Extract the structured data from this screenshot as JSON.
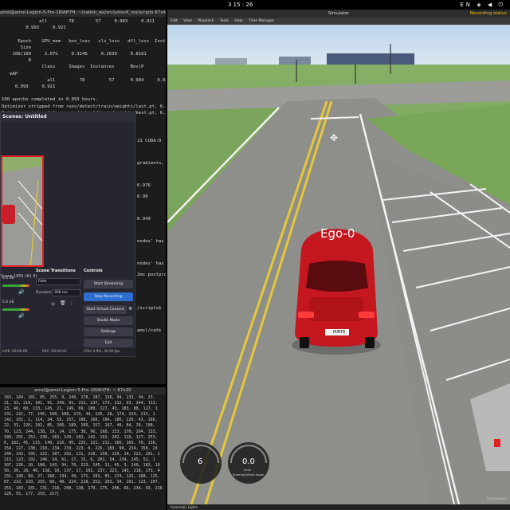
{
  "topbar": {
    "left_label": "",
    "clock": "3  15 : 26",
    "right_label": "EN"
  },
  "term1": {
    "title": "amsl@amsl-Legion-5-Pro-16IAH7H: ~/catkin_ws/src/yolov8_ros/scripts 67x41",
    "lines": [
      "              all        78        57     0.983     0.921",
      "         0.993     0.921",
      "",
      "      Epoch    GPU_mem   box_loss   cls_loss   dfl_loss  Instances",
      "       Size",
      "    100/100     2.07G     0.3246     0.2639     0.8181         0",
      "          8",
      "               Class     Images  Instances      Box(P",
      "   mAP",
      "                 all         78         57      0.984     0.983",
      "     0.993     0.921",
      "",
      "100 epochs completed in 0.093 hours.",
      "Optimizer stripped from runs/detect/train/weights/last.pt, 6.3MB",
      "Optimizer stripped from runs/detect/train/weights/best.pt, 6.3MB"
    ],
    "side_lines": [
      "",
      "",
      "",
      "",
      "11 CUDA:0",
      "",
      "gradients,",
      "",
      "0.976",
      "0.98",
      "",
      "0.949",
      "",
      "nodes' has",
      "",
      "nodes' has",
      "2ms postpro",
      "",
      "",
      "/scripts$",
      "",
      "amsl/catk"
    ]
  },
  "term2": {
    "title": "amsl@amsl-Legion-5-Pro-16IAH7H: ~ 67x20",
    "lines": [
      " 183, 184, 181, 85, 255, 9, 240, 178, 187, 136, 94, 233, 94, 23,",
      " 21, 33, 219, 101, 91, 240, 91, 213, 237, 173, 212, 93, 244, 113,",
      " 23, 48, 60, 133, 145, 21, 149, 69, 100, 127, 43, 183, 88, 117, 1",
      " 231, 221, 77, 146, 168, 188, 219, 49, 126, 28, 174, 226, 215, 1",
      " 142, 101, 1, 114, 34, 53, 157, 108, 160, 184, 186, 226, 43, 166,",
      " 22, 31, 126, 102, 85, 206, 189, 109, 157, 167, 46, 84, 29, 190,",
      " 70, 123, 244, 138, 19, 14, 175, 30, 96, 198, 153, 170, 204, 133,",
      " 180, 201, 252, 230, 163, 143, 102, 142, 192, 202, 119, 127, 253,",
      " 6, 181, 45, 115, 140, 216, 45, 225, 221, 211, 166, 165, 70, 116,",
      " 154, 127, 138, 210, 234, 233, 223, 0, 226, 183, 98, 234, 158, 23",
      " 249, 142, 105, 222, 187, 162, 131, 228, 150, 129, 14, 223, 201, 2",
      " 115, 123, 102, 246, 34, 61, 27, 15, 6, 201, 54, 234, 245, 52, 1",
      " 107, 226, 20, 188, 143, 94, 70, 223, 145, 31, 45, 3, 240, 182, 19",
      " 50, 30, 28, 40, 138, 10, 137, 17, 102, 237, 223, 143, 218, 173, 4",
      " 231, 100, 89, 27, 168, 134, 49, 171, 101, 85, 174, 125, 168, 125,",
      " 87, 232, 210, 255, 60, 40, 224, 218, 252, 203, 34, 191, 123, 107,",
      " 253, 183, 181, 131, 218, 208, 138, 179, 175, 206, 66, 234, 93, 226",
      " 120, 55, 177, 255, 217]"
    ]
  },
  "obs": {
    "title": "Scenes: Untitled",
    "scene_label": "Scene 1650 (#1 0)",
    "transitions_title": "Scene Transitions",
    "transition_type": "Fade",
    "duration_label": "Duration",
    "duration_value": "300 ms",
    "controls_title": "Controls",
    "buttons": [
      "Start Streaming",
      "Stop Recording",
      "Start Virtual Camera",
      "Studio Mode",
      "Settings",
      "Exit"
    ],
    "mixer": [
      "0.0 dB",
      "0.0 dB"
    ],
    "status": {
      "live": "LIVE: 00:00:00",
      "rec": "REC: 00:00:01",
      "cpu": "CPU: 0.9%, 30.00 fps"
    }
  },
  "sim": {
    "window_title": "Simulator",
    "menu": [
      "Edit",
      "View",
      "Playback",
      "Tools",
      "Help",
      "Time Manager"
    ],
    "rec_label": "Recording status",
    "car_label": "Ego-0",
    "plate": "HUMTB",
    "gear": "6",
    "speed": "0.0",
    "speed_unit": "km/h",
    "steer_label": "Steering Wheel Angle",
    "bottom": "Automatic Lights",
    "corner_text": "3.5.0.50.8.0.1"
  },
  "colors": {
    "accent": "#2d6ecf",
    "record": "#e01b24",
    "grass": "#7da85a",
    "asphalt": "#8a8a88",
    "lane_yellow": "#e6c73a"
  }
}
